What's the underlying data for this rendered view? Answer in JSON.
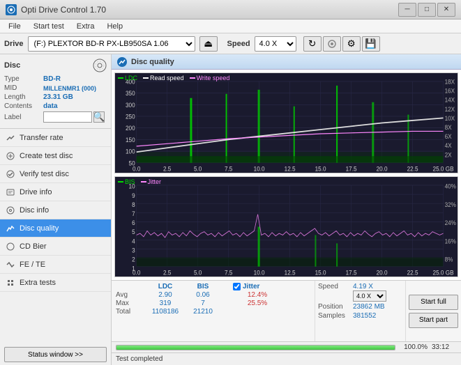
{
  "app": {
    "title": "Opti Drive Control 1.70",
    "icon": "disc-icon"
  },
  "titlebar": {
    "minimize": "─",
    "maximize": "□",
    "close": "✕"
  },
  "menubar": {
    "items": [
      "File",
      "Start test",
      "Extra",
      "Help"
    ]
  },
  "drivebar": {
    "label": "Drive",
    "drive_display": "(F:)  PLEXTOR BD-R  PX-LB950SA 1.06",
    "speed_label": "Speed",
    "speed_value": "4.0 X"
  },
  "disc": {
    "title": "Disc",
    "type_label": "Type",
    "type_value": "BD-R",
    "mid_label": "MID",
    "mid_value": "MILLENMR1 (000)",
    "length_label": "Length",
    "length_value": "23.31 GB",
    "contents_label": "Contents",
    "contents_value": "data",
    "label_label": "Label",
    "label_placeholder": ""
  },
  "nav": {
    "items": [
      {
        "id": "transfer-rate",
        "label": "Transfer rate",
        "active": false
      },
      {
        "id": "create-test-disc",
        "label": "Create test disc",
        "active": false
      },
      {
        "id": "verify-test-disc",
        "label": "Verify test disc",
        "active": false
      },
      {
        "id": "drive-info",
        "label": "Drive info",
        "active": false
      },
      {
        "id": "disc-info",
        "label": "Disc info",
        "active": false
      },
      {
        "id": "disc-quality",
        "label": "Disc quality",
        "active": true
      },
      {
        "id": "cd-bier",
        "label": "CD Bier",
        "active": false
      },
      {
        "id": "fe-te",
        "label": "FE / TE",
        "active": false
      },
      {
        "id": "extra-tests",
        "label": "Extra tests",
        "active": false
      }
    ]
  },
  "status_btn": "Status window >>",
  "quality": {
    "title": "Disc quality",
    "legend": {
      "ldc": "LDC",
      "read_speed": "Read speed",
      "write_speed": "Write speed",
      "bis": "BIS",
      "jitter": "Jitter"
    }
  },
  "chart1": {
    "y_max": 400,
    "y_labels_left": [
      "400",
      "350",
      "300",
      "250",
      "200",
      "150",
      "100",
      "50"
    ],
    "y_labels_right": [
      "18X",
      "16X",
      "14X",
      "12X",
      "10X",
      "8X",
      "6X",
      "4X",
      "2X"
    ],
    "x_labels": [
      "0.0",
      "2.5",
      "5.0",
      "7.5",
      "10.0",
      "12.5",
      "15.0",
      "17.5",
      "20.0",
      "22.5",
      "25.0 GB"
    ]
  },
  "chart2": {
    "y_labels_left": [
      "10",
      "9",
      "8",
      "7",
      "6",
      "5",
      "4",
      "3",
      "2",
      "1"
    ],
    "y_labels_right": [
      "40%",
      "32%",
      "24%",
      "16%",
      "8%"
    ],
    "x_labels": [
      "0.0",
      "2.5",
      "5.0",
      "7.5",
      "10.0",
      "12.5",
      "15.0",
      "17.5",
      "20.0",
      "22.5",
      "25.0 GB"
    ]
  },
  "stats": {
    "headers": [
      "",
      "LDC",
      "BIS",
      "",
      "Jitter",
      "Speed",
      "",
      ""
    ],
    "avg_label": "Avg",
    "avg_ldc": "2.90",
    "avg_bis": "0.06",
    "avg_jitter": "12.4%",
    "max_label": "Max",
    "max_ldc": "319",
    "max_bis": "7",
    "max_jitter": "25.5%",
    "total_label": "Total",
    "total_ldc": "1108186",
    "total_bis": "21210",
    "speed_value": "4.19 X",
    "speed_target": "4.0 X",
    "position_label": "Position",
    "position_value": "23862 MB",
    "samples_label": "Samples",
    "samples_value": "381552",
    "jitter_checked": true,
    "jitter_label": "Jitter"
  },
  "buttons": {
    "start_full": "Start full",
    "start_part": "Start part"
  },
  "progress": {
    "percent": "100.0%",
    "fill": 100,
    "time": "33:12"
  },
  "statusbar": {
    "text": "Test completed"
  }
}
